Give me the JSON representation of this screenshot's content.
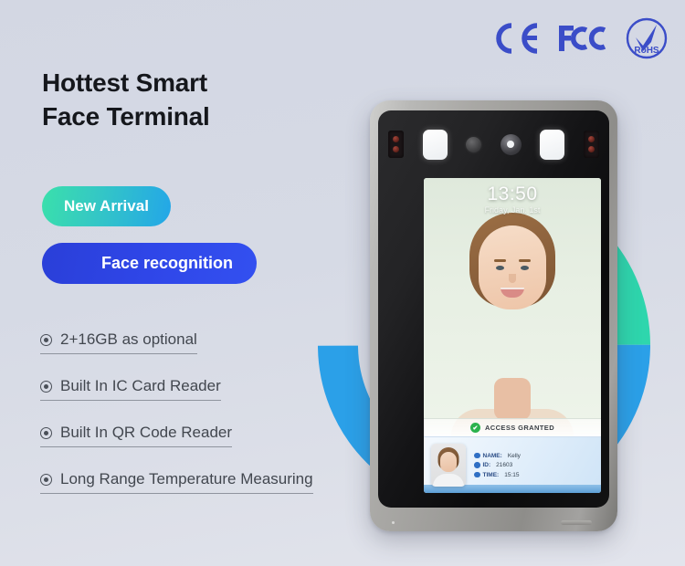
{
  "headline": {
    "line1": "Hottest Smart",
    "line2": "Face Terminal"
  },
  "certifications": [
    {
      "name": "ce-badge",
      "label": "CE"
    },
    {
      "name": "fcc-badge",
      "label": "FC"
    },
    {
      "name": "rohs-badge",
      "label": "RoHS"
    }
  ],
  "pills": {
    "new_arrival": "New Arrival",
    "face_recognition": "Face recognition"
  },
  "features": [
    {
      "label": "2+16GB as optional"
    },
    {
      "label": "Built In IC Card Reader"
    },
    {
      "label": "Built In QR Code Reader"
    },
    {
      "label": "Long Range Temperature Measuring"
    }
  ],
  "device": {
    "screen": {
      "clock_time": "13:50",
      "clock_date": "Friday, Jan. 1st",
      "access_status": "ACCESS GRANTED",
      "check_mark": "✔",
      "record": {
        "name_key": "NAME:",
        "name_value": "Kelly",
        "id_key": "ID:",
        "id_value": "21603",
        "time_key": "TIME:",
        "time_value": "15:15"
      }
    }
  },
  "colors": {
    "background": "#d3d7e3",
    "ring_teal": "#2ed6ad",
    "ring_blue": "#2ba0e8",
    "pill_blue": "#2f46e8",
    "cert_blue": "#3b4dc8",
    "status_green": "#2bb24c",
    "text_dark": "#15171c",
    "text_feature": "#42474f"
  }
}
